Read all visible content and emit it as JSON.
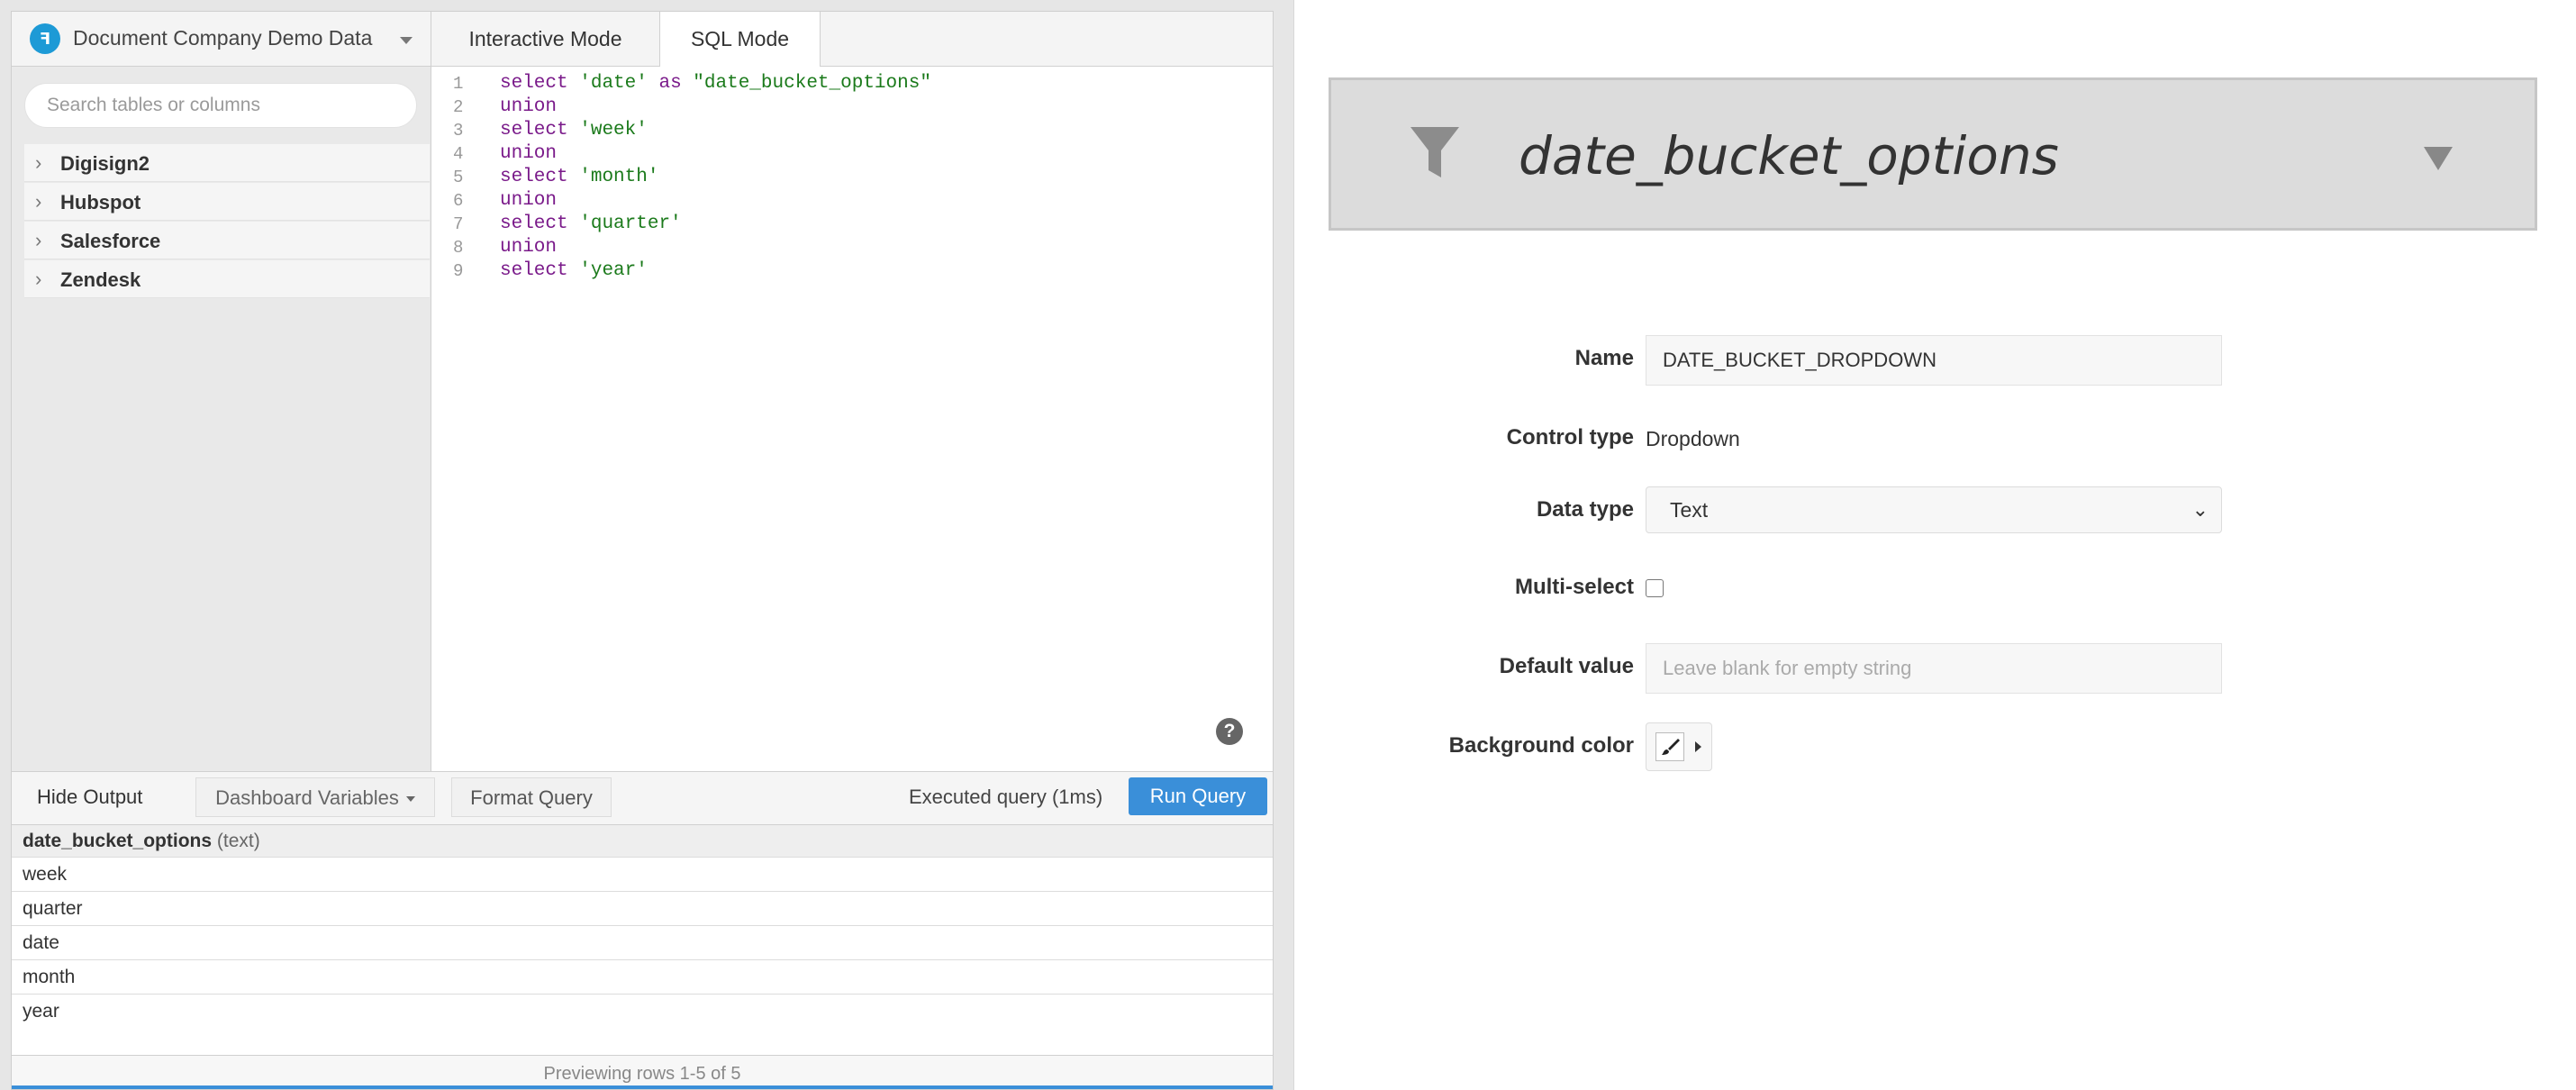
{
  "datasource": {
    "name": "Document Company Demo Data",
    "logo_glyph": "ꟻ"
  },
  "tabs": [
    {
      "label": "Interactive Mode",
      "active": false
    },
    {
      "label": "SQL Mode",
      "active": true
    }
  ],
  "schema": {
    "search_placeholder": "Search tables or columns",
    "items": [
      {
        "label": "Digisign2"
      },
      {
        "label": "Hubspot"
      },
      {
        "label": "Salesforce"
      },
      {
        "label": "Zendesk"
      }
    ]
  },
  "editor": {
    "lines": [
      {
        "n": "1",
        "kw": "select",
        "str": "'date'",
        "kw2": "as",
        "str2": "\"date_bucket_options\""
      },
      {
        "n": "2",
        "kw": "union",
        "str": "",
        "kw2": "",
        "str2": ""
      },
      {
        "n": "3",
        "kw": "select",
        "str": "'week'",
        "kw2": "",
        "str2": ""
      },
      {
        "n": "4",
        "kw": "union",
        "str": "",
        "kw2": "",
        "str2": ""
      },
      {
        "n": "5",
        "kw": "select",
        "str": "'month'",
        "kw2": "",
        "str2": ""
      },
      {
        "n": "6",
        "kw": "union",
        "str": "",
        "kw2": "",
        "str2": ""
      },
      {
        "n": "7",
        "kw": "select",
        "str": "'quarter'",
        "kw2": "",
        "str2": ""
      },
      {
        "n": "8",
        "kw": "union",
        "str": "",
        "kw2": "",
        "str2": ""
      },
      {
        "n": "9",
        "kw": "select",
        "str": "'year'",
        "kw2": "",
        "str2": ""
      }
    ],
    "help_glyph": "?"
  },
  "toolbar": {
    "hide_output": "Hide Output",
    "dashboard_variables": "Dashboard Variables",
    "format_query": "Format Query",
    "status": "Executed query (1ms)",
    "run_query": "Run Query"
  },
  "results": {
    "column": "date_bucket_options",
    "column_type": "(text)",
    "rows": [
      "week",
      "quarter",
      "date",
      "month",
      "year"
    ],
    "footer": "Previewing rows 1-5 of 5"
  },
  "filter_preview": {
    "title": "date_bucket_options"
  },
  "form": {
    "name_label": "Name",
    "name_value": "DATE_BUCKET_DROPDOWN",
    "control_type_label": "Control type",
    "control_type_value": "Dropdown",
    "data_type_label": "Data type",
    "data_type_value": "Text",
    "multiselect_label": "Multi-select",
    "multiselect_checked": false,
    "default_label": "Default value",
    "default_placeholder": "Leave blank for empty string",
    "bgcolor_label": "Background color"
  },
  "colors": {
    "accent": "#3a8fd9",
    "logo": "#1d9ad6",
    "sql_keyword": "#7a1a8a",
    "sql_string": "#1b7a1b",
    "filter_bg": "#dcdcdc"
  },
  "icons": {
    "filter": "filter-funnel-icon",
    "brush": "paintbrush-icon",
    "help": "help-circle-icon"
  }
}
